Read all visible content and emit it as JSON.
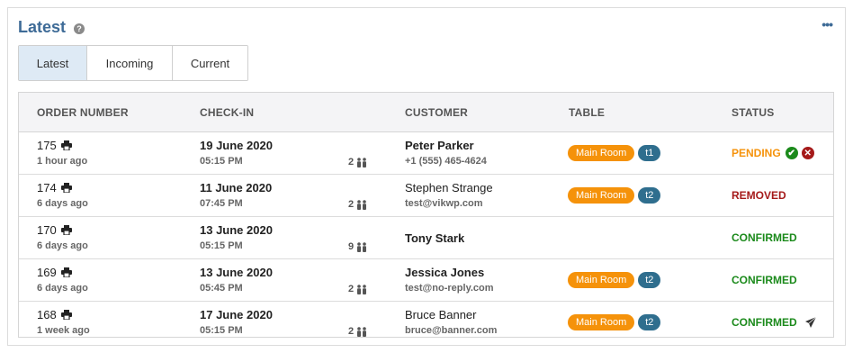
{
  "panel": {
    "title": "Latest",
    "help_icon": "question-icon",
    "more_icon": "ellipsis-icon"
  },
  "tabs": [
    {
      "label": "Latest",
      "active": true
    },
    {
      "label": "Incoming",
      "active": false
    },
    {
      "label": "Current",
      "active": false
    }
  ],
  "table": {
    "headers": {
      "order": "ORDER NUMBER",
      "checkin": "CHECK-IN",
      "customer": "CUSTOMER",
      "table": "TABLE",
      "status": "STATUS"
    },
    "rows": [
      {
        "order": "175",
        "ago": "1 hour ago",
        "date": "19 June 2020",
        "time": "05:15 PM",
        "guests": "2",
        "customer": "Peter Parker",
        "contact": "+1 (555) 465-4624",
        "room": "Main Room",
        "table": "t1",
        "status": "PENDING"
      },
      {
        "order": "174",
        "ago": "6 days ago",
        "date": "11 June 2020",
        "time": "07:45 PM",
        "guests": "2",
        "customer": "Stephen Strange",
        "contact": "test@vikwp.com",
        "room": "Main Room",
        "table": "t2",
        "status": "REMOVED"
      },
      {
        "order": "170",
        "ago": "6 days ago",
        "date": "13 June 2020",
        "time": "05:15 PM",
        "guests": "9",
        "customer": "Tony Stark",
        "contact": "",
        "room": "",
        "table": "",
        "status": "CONFIRMED"
      },
      {
        "order": "169",
        "ago": "6 days ago",
        "date": "13 June 2020",
        "time": "05:45 PM",
        "guests": "2",
        "customer": "Jessica Jones",
        "contact": "test@no-reply.com",
        "room": "Main Room",
        "table": "t2",
        "status": "CONFIRMED"
      },
      {
        "order": "168",
        "ago": "1 week ago",
        "date": "17 June 2020",
        "time": "05:15 PM",
        "guests": "2",
        "customer": "Bruce Banner",
        "contact": "bruce@banner.com",
        "room": "Main Room",
        "table": "t2",
        "status": "CONFIRMED"
      }
    ]
  },
  "colors": {
    "title": "#3e6b97",
    "pending": "#f5920a",
    "removed": "#a51a1a",
    "confirmed": "#1b8a1b",
    "room_badge": "#f5920a",
    "table_badge": "#2f6e8e",
    "active_tab": "#deeaf5"
  }
}
